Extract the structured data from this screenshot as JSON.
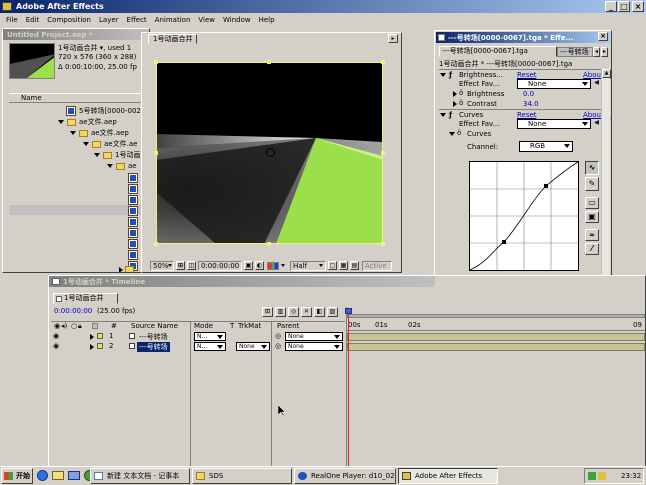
{
  "app": {
    "title": "Adobe After Effects",
    "menu": [
      "File",
      "Edit",
      "Composition",
      "Layer",
      "Effect",
      "Animation",
      "View",
      "Window",
      "Help"
    ]
  },
  "project": {
    "title": "Untitled Project.aep *",
    "info_line1": "1号动画合并 ▾, used 1",
    "info_line2": "720 x 576  (360 x 288)",
    "info_line3": "Δ 0:00:10:00, 25.00 fp",
    "column_name": "Name",
    "tree": [
      {
        "label": "5号转场[0000-002"
      },
      {
        "label": "ae文件.aep"
      },
      {
        "label": "ae文件.aep"
      },
      {
        "label": "ae文件.ae"
      },
      {
        "label": "1号动画"
      },
      {
        "label": "ae"
      }
    ]
  },
  "comp": {
    "tab": "1号动画合并",
    "zoom": "50%",
    "timecode": "0:00:00:00",
    "resolution": "Half",
    "active_label": "Active"
  },
  "effects": {
    "title": "---号转场[0000-0067].tga * Effe...",
    "tab_active": "---号转场[0000-0067].tga",
    "tab_other": "---号转场",
    "breadcrumb": "1号动画合并 * ---号转场[0000-0067].tga",
    "brightness": {
      "name": "Brightness...",
      "reset": "Reset",
      "about": "About...",
      "fav_label": "Effect Fav...",
      "fav_value": "None",
      "param1_label": "Brightness",
      "param1_value": "0.0",
      "param2_label": "Contrast",
      "param2_value": "34.0"
    },
    "curves": {
      "name": "Curves",
      "reset": "Reset",
      "about": "About...",
      "fav_label": "Effect Fav...",
      "fav_value": "None",
      "sub_label": "Curves",
      "channel_label": "Channel:",
      "channel_value": "RGB"
    }
  },
  "timeline": {
    "title": "1号动画合并 * Timeline",
    "tab": "1号动画合并",
    "timecode": "0:00:00:00",
    "fps": "(25.00 fps)",
    "columns": {
      "num": "#",
      "source": "Source Name",
      "mode": "Mode",
      "t": "T",
      "trkmat": "TrkMat",
      "parent": "Parent"
    },
    "ruler": [
      "00s",
      "01s",
      "02s"
    ],
    "ruler_right": "09",
    "layers": [
      {
        "num": "1",
        "name": "---号转场",
        "mode": "N...",
        "trkmat": "",
        "parent": "None"
      },
      {
        "num": "2",
        "name": "---号转场",
        "mode": "N...",
        "trkmat": "None",
        "parent": "None"
      }
    ]
  },
  "taskbar": {
    "start": "开始",
    "items": [
      {
        "label": "新建 文本文档 - 记事本"
      },
      {
        "label": "SDS"
      },
      {
        "label": "RealOne Player: d10_02..."
      },
      {
        "label": "Adobe After Effects"
      }
    ],
    "clock": "23:32"
  },
  "colors": {
    "title_blue": "#0a246a",
    "green_shape": "#9be04a",
    "playhead": "#e02020",
    "layer_bar": "#c8c498"
  }
}
